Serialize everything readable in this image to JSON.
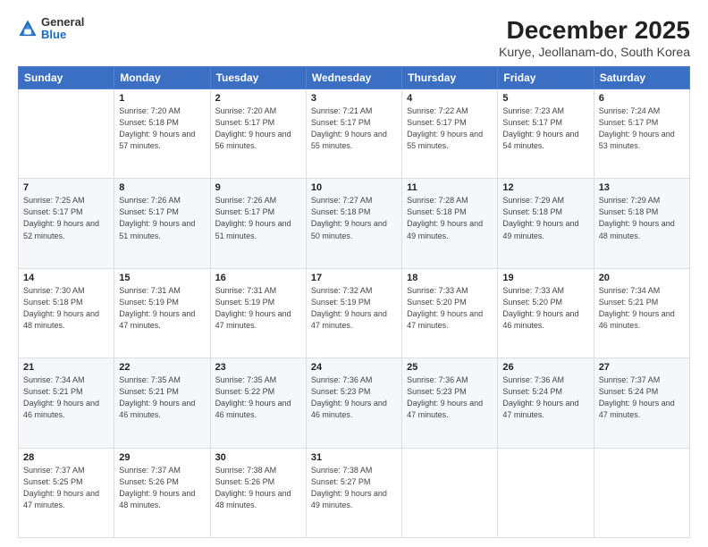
{
  "header": {
    "logo_general": "General",
    "logo_blue": "Blue",
    "title": "December 2025",
    "subtitle": "Kurye, Jeollanam-do, South Korea"
  },
  "calendar": {
    "days": [
      "Sunday",
      "Monday",
      "Tuesday",
      "Wednesday",
      "Thursday",
      "Friday",
      "Saturday"
    ],
    "weeks": [
      [
        {
          "num": "",
          "sunrise": "",
          "sunset": "",
          "daylight": ""
        },
        {
          "num": "1",
          "sunrise": "Sunrise: 7:20 AM",
          "sunset": "Sunset: 5:18 PM",
          "daylight": "Daylight: 9 hours and 57 minutes."
        },
        {
          "num": "2",
          "sunrise": "Sunrise: 7:20 AM",
          "sunset": "Sunset: 5:17 PM",
          "daylight": "Daylight: 9 hours and 56 minutes."
        },
        {
          "num": "3",
          "sunrise": "Sunrise: 7:21 AM",
          "sunset": "Sunset: 5:17 PM",
          "daylight": "Daylight: 9 hours and 55 minutes."
        },
        {
          "num": "4",
          "sunrise": "Sunrise: 7:22 AM",
          "sunset": "Sunset: 5:17 PM",
          "daylight": "Daylight: 9 hours and 55 minutes."
        },
        {
          "num": "5",
          "sunrise": "Sunrise: 7:23 AM",
          "sunset": "Sunset: 5:17 PM",
          "daylight": "Daylight: 9 hours and 54 minutes."
        },
        {
          "num": "6",
          "sunrise": "Sunrise: 7:24 AM",
          "sunset": "Sunset: 5:17 PM",
          "daylight": "Daylight: 9 hours and 53 minutes."
        }
      ],
      [
        {
          "num": "7",
          "sunrise": "Sunrise: 7:25 AM",
          "sunset": "Sunset: 5:17 PM",
          "daylight": "Daylight: 9 hours and 52 minutes."
        },
        {
          "num": "8",
          "sunrise": "Sunrise: 7:26 AM",
          "sunset": "Sunset: 5:17 PM",
          "daylight": "Daylight: 9 hours and 51 minutes."
        },
        {
          "num": "9",
          "sunrise": "Sunrise: 7:26 AM",
          "sunset": "Sunset: 5:17 PM",
          "daylight": "Daylight: 9 hours and 51 minutes."
        },
        {
          "num": "10",
          "sunrise": "Sunrise: 7:27 AM",
          "sunset": "Sunset: 5:18 PM",
          "daylight": "Daylight: 9 hours and 50 minutes."
        },
        {
          "num": "11",
          "sunrise": "Sunrise: 7:28 AM",
          "sunset": "Sunset: 5:18 PM",
          "daylight": "Daylight: 9 hours and 49 minutes."
        },
        {
          "num": "12",
          "sunrise": "Sunrise: 7:29 AM",
          "sunset": "Sunset: 5:18 PM",
          "daylight": "Daylight: 9 hours and 49 minutes."
        },
        {
          "num": "13",
          "sunrise": "Sunrise: 7:29 AM",
          "sunset": "Sunset: 5:18 PM",
          "daylight": "Daylight: 9 hours and 48 minutes."
        }
      ],
      [
        {
          "num": "14",
          "sunrise": "Sunrise: 7:30 AM",
          "sunset": "Sunset: 5:18 PM",
          "daylight": "Daylight: 9 hours and 48 minutes."
        },
        {
          "num": "15",
          "sunrise": "Sunrise: 7:31 AM",
          "sunset": "Sunset: 5:19 PM",
          "daylight": "Daylight: 9 hours and 47 minutes."
        },
        {
          "num": "16",
          "sunrise": "Sunrise: 7:31 AM",
          "sunset": "Sunset: 5:19 PM",
          "daylight": "Daylight: 9 hours and 47 minutes."
        },
        {
          "num": "17",
          "sunrise": "Sunrise: 7:32 AM",
          "sunset": "Sunset: 5:19 PM",
          "daylight": "Daylight: 9 hours and 47 minutes."
        },
        {
          "num": "18",
          "sunrise": "Sunrise: 7:33 AM",
          "sunset": "Sunset: 5:20 PM",
          "daylight": "Daylight: 9 hours and 47 minutes."
        },
        {
          "num": "19",
          "sunrise": "Sunrise: 7:33 AM",
          "sunset": "Sunset: 5:20 PM",
          "daylight": "Daylight: 9 hours and 46 minutes."
        },
        {
          "num": "20",
          "sunrise": "Sunrise: 7:34 AM",
          "sunset": "Sunset: 5:21 PM",
          "daylight": "Daylight: 9 hours and 46 minutes."
        }
      ],
      [
        {
          "num": "21",
          "sunrise": "Sunrise: 7:34 AM",
          "sunset": "Sunset: 5:21 PM",
          "daylight": "Daylight: 9 hours and 46 minutes."
        },
        {
          "num": "22",
          "sunrise": "Sunrise: 7:35 AM",
          "sunset": "Sunset: 5:21 PM",
          "daylight": "Daylight: 9 hours and 46 minutes."
        },
        {
          "num": "23",
          "sunrise": "Sunrise: 7:35 AM",
          "sunset": "Sunset: 5:22 PM",
          "daylight": "Daylight: 9 hours and 46 minutes."
        },
        {
          "num": "24",
          "sunrise": "Sunrise: 7:36 AM",
          "sunset": "Sunset: 5:23 PM",
          "daylight": "Daylight: 9 hours and 46 minutes."
        },
        {
          "num": "25",
          "sunrise": "Sunrise: 7:36 AM",
          "sunset": "Sunset: 5:23 PM",
          "daylight": "Daylight: 9 hours and 47 minutes."
        },
        {
          "num": "26",
          "sunrise": "Sunrise: 7:36 AM",
          "sunset": "Sunset: 5:24 PM",
          "daylight": "Daylight: 9 hours and 47 minutes."
        },
        {
          "num": "27",
          "sunrise": "Sunrise: 7:37 AM",
          "sunset": "Sunset: 5:24 PM",
          "daylight": "Daylight: 9 hours and 47 minutes."
        }
      ],
      [
        {
          "num": "28",
          "sunrise": "Sunrise: 7:37 AM",
          "sunset": "Sunset: 5:25 PM",
          "daylight": "Daylight: 9 hours and 47 minutes."
        },
        {
          "num": "29",
          "sunrise": "Sunrise: 7:37 AM",
          "sunset": "Sunset: 5:26 PM",
          "daylight": "Daylight: 9 hours and 48 minutes."
        },
        {
          "num": "30",
          "sunrise": "Sunrise: 7:38 AM",
          "sunset": "Sunset: 5:26 PM",
          "daylight": "Daylight: 9 hours and 48 minutes."
        },
        {
          "num": "31",
          "sunrise": "Sunrise: 7:38 AM",
          "sunset": "Sunset: 5:27 PM",
          "daylight": "Daylight: 9 hours and 49 minutes."
        },
        {
          "num": "",
          "sunrise": "",
          "sunset": "",
          "daylight": ""
        },
        {
          "num": "",
          "sunrise": "",
          "sunset": "",
          "daylight": ""
        },
        {
          "num": "",
          "sunrise": "",
          "sunset": "",
          "daylight": ""
        }
      ]
    ]
  }
}
